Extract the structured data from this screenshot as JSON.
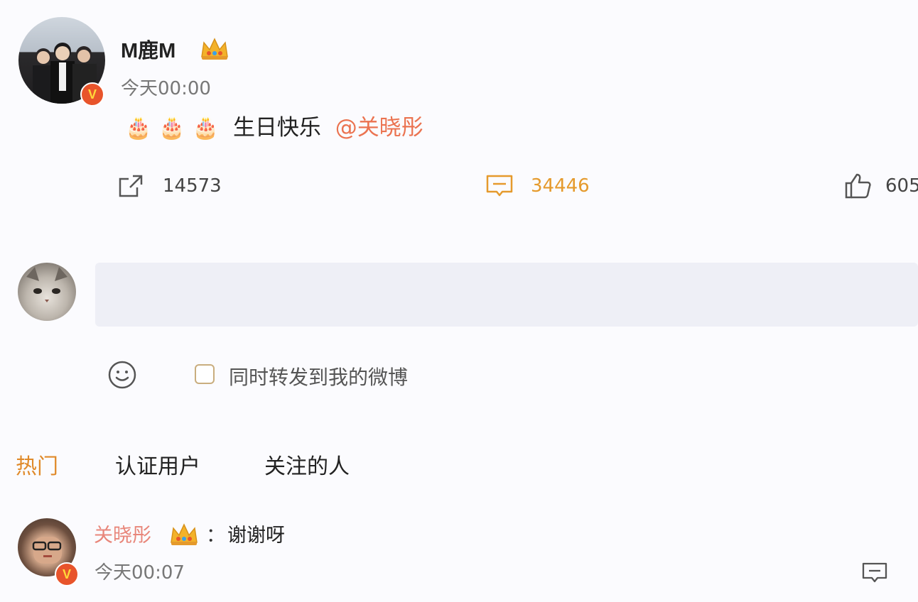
{
  "post": {
    "username": "M鹿M",
    "timestamp": "今天00:00",
    "cakes": [
      "🎂",
      "🎂",
      "🎂"
    ],
    "text": "生日快乐",
    "mention": "@关晓彤",
    "actions": {
      "repost_count": "14573",
      "comment_count": "34446",
      "like_count": "605"
    }
  },
  "composer": {
    "repost_label": "同时转发到我的微博"
  },
  "tabs": [
    {
      "label": "热门",
      "active": true
    },
    {
      "label": "认证用户",
      "active": false
    },
    {
      "label": "关注的人",
      "active": false
    }
  ],
  "reply": {
    "username": "关晓彤",
    "colon": "：",
    "text": "谢谢呀",
    "timestamp": "今天00:07"
  },
  "badges": {
    "verified_letter": "V"
  },
  "colors": {
    "accent_orange": "#e59a2c",
    "mention": "#eb7350",
    "badge": "#e8542b"
  }
}
